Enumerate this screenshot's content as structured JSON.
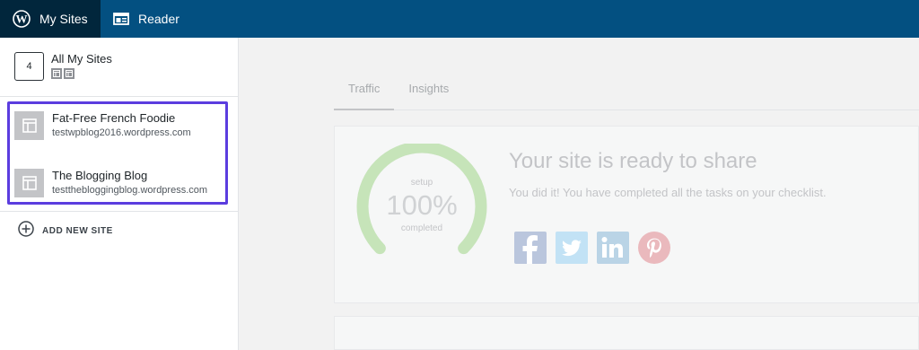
{
  "topbar": {
    "my_sites_label": "My Sites",
    "reader_label": "Reader"
  },
  "sidebar": {
    "all_sites": {
      "count": "4",
      "title": "All My Sites"
    },
    "sites": [
      {
        "name": "Fat-Free French Foodie",
        "url": "testwpblog2016.wordpress.com"
      },
      {
        "name": "The Blogging Blog",
        "url": "testthebloggingblog.wordpress.com"
      }
    ],
    "add_new_site_label": "ADD NEW SITE"
  },
  "main": {
    "tabs": [
      {
        "label": "Traffic"
      },
      {
        "label": "Insights"
      }
    ],
    "checklist": {
      "gauge_top": "setup",
      "gauge_percent": "100%",
      "gauge_bottom": "completed",
      "progress": 1.0,
      "title": "Your site is ready to share",
      "text": "You did it! You have completed all the tasks on your checklist."
    },
    "share_icons": [
      "facebook-icon",
      "twitter-icon",
      "linkedin-icon",
      "pinterest-icon"
    ]
  },
  "colors": {
    "topbar": "#035081",
    "topbar_active": "#01263c",
    "highlight_border": "#5b3ddf",
    "gauge": "#c6e4b9",
    "facebook": "#bac6dd",
    "twitter": "#c2e2f5",
    "linkedin": "#bad4e6",
    "pinterest": "#eab9bd"
  }
}
